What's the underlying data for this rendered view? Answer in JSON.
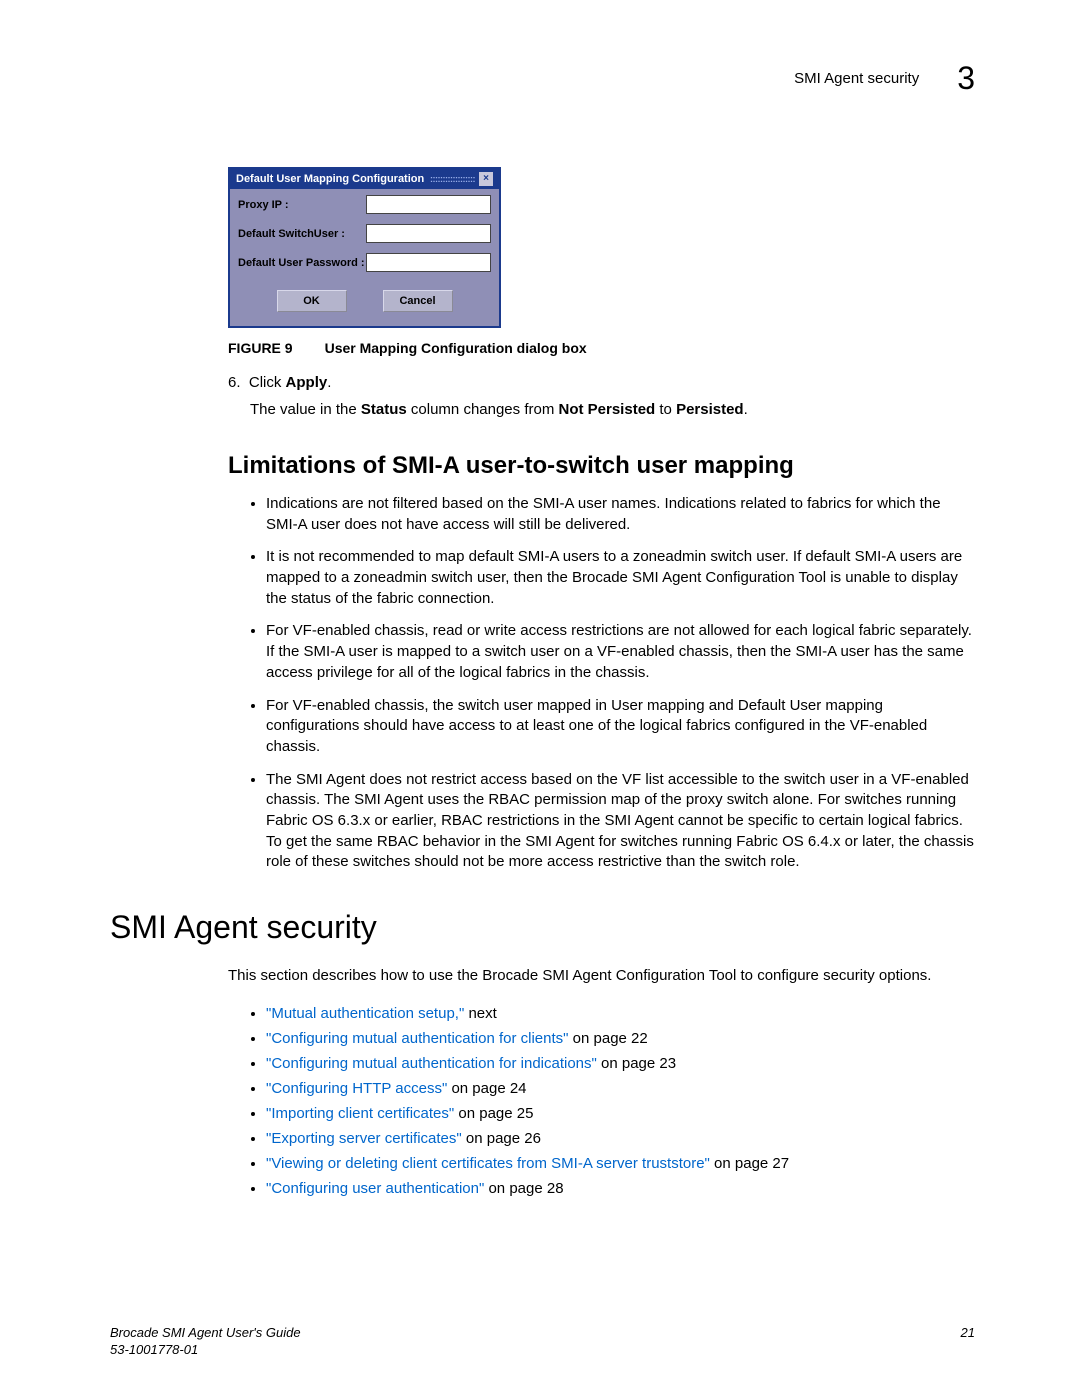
{
  "header": {
    "title": "SMI Agent security",
    "chapter": "3"
  },
  "dialog": {
    "title": "Default User Mapping Configuration",
    "rows": [
      {
        "label": "Proxy IP :"
      },
      {
        "label": "Default SwitchUser :"
      },
      {
        "label": "Default User Password :"
      }
    ],
    "ok": "OK",
    "cancel": "Cancel"
  },
  "figure": {
    "label": "FIGURE 9",
    "caption": "User Mapping Configuration dialog box"
  },
  "step": {
    "num": "6.",
    "pre": "Click ",
    "bold": "Apply",
    "post": "."
  },
  "step_note": {
    "p1": "The value in the ",
    "b1": "Status",
    "p2": " column changes from ",
    "b2": "Not Persisted",
    "p3": " to ",
    "b3": "Persisted",
    "p4": "."
  },
  "subheading": "Limitations of SMI-A user-to-switch user mapping",
  "limitations": [
    "Indications are not filtered based on the SMI-A user names. Indications related to fabrics for which the SMI-A user does not have access will still be delivered.",
    "It is not recommended to map default SMI-A users to a zoneadmin switch user. If default SMI-A users are mapped to a zoneadmin switch user, then the Brocade SMI Agent Configuration Tool is unable to display the status of the fabric connection.",
    "For VF-enabled chassis, read or write access restrictions are not allowed for each logical fabric separately. If the SMI-A user is mapped to a switch user on a VF-enabled chassis, then the SMI-A user has the same access privilege for all of the logical fabrics in the chassis.",
    "For VF-enabled chassis, the switch user mapped in User mapping and Default User mapping configurations should have access to at least one of the logical fabrics configured in the VF-enabled chassis.",
    "The SMI Agent does not restrict access based on the VF list accessible to the switch user in a VF-enabled chassis. The SMI Agent uses the RBAC permission map of the proxy switch alone. For switches running Fabric OS 6.3.x or earlier, RBAC restrictions in the SMI Agent cannot be specific to certain logical fabrics. To get the same RBAC behavior in the SMI Agent for switches running Fabric OS 6.4.x or later, the chassis role of these switches should not be more access restrictive than the switch role."
  ],
  "section_title": "SMI Agent security",
  "section_intro": "This section describes how to use the Brocade SMI Agent Configuration Tool to configure security options.",
  "links": [
    {
      "text": "\"Mutual authentication setup,\"",
      "suffix": " next"
    },
    {
      "text": "\"Configuring mutual authentication for clients\"",
      "suffix": " on page 22"
    },
    {
      "text": "\"Configuring mutual authentication for indications\"",
      "suffix": " on page 23"
    },
    {
      "text": "\"Configuring HTTP access\"",
      "suffix": " on page 24"
    },
    {
      "text": "\"Importing client certificates\"",
      "suffix": " on page 25"
    },
    {
      "text": "\"Exporting server certificates\"",
      "suffix": " on page 26"
    },
    {
      "text": "\"Viewing or deleting client certificates from SMI-A server truststore\"",
      "suffix": " on page 27"
    },
    {
      "text": "\"Configuring user authentication\"",
      "suffix": " on page 28"
    }
  ],
  "footer": {
    "guide": "Brocade SMI Agent User's Guide",
    "docnum": "53-1001778-01",
    "page": "21"
  }
}
